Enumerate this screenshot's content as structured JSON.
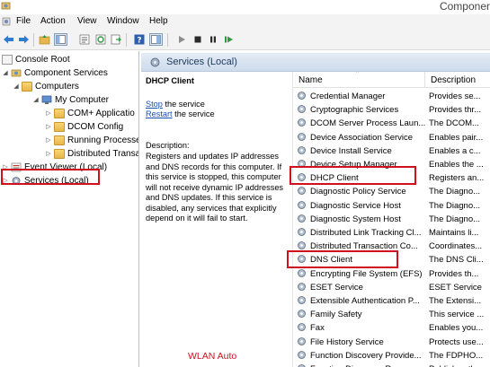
{
  "window": {
    "title": "Componer"
  },
  "menu": {
    "items": [
      "File",
      "Action",
      "View",
      "Window",
      "Help"
    ]
  },
  "toolbar": {
    "buttons": [
      "back-arrow-icon",
      "forward-arrow-icon",
      "up-folder-icon",
      "show-tree-icon",
      "properties-icon",
      "refresh-icon",
      "export-icon",
      "help-icon",
      "console-tree-icon",
      "play-icon",
      "stop-icon",
      "pause-icon",
      "restart-icon"
    ]
  },
  "tree": {
    "root": "Console Root",
    "component_services": "Component Services",
    "computers": "Computers",
    "my_computer": "My Computer",
    "com_apps": "COM+ Applicatio",
    "dcom_config": "DCOM Config",
    "running_processes": "Running Processe",
    "distributed_trans": "Distributed Transa",
    "event_viewer": "Event Viewer (Local)",
    "services_local": "Services (Local)"
  },
  "panel": {
    "header": "Services (Local)"
  },
  "description": {
    "service_name": "DHCP Client",
    "stop_link": "Stop",
    "stop_suffix": " the service",
    "restart_link": "Restart",
    "restart_suffix": " the service",
    "label": "Description:",
    "text": "Registers and updates IP addresses and DNS records for this computer. If this service is stopped, this computer will not receive dynamic IP addresses and DNS updates. If this service is disabled, any services that explicitly depend on it will fail to start."
  },
  "services_list": {
    "columns": {
      "name": "Name",
      "description": "Description"
    },
    "rows": [
      {
        "name": "Credential Manager",
        "description": "Provides se..."
      },
      {
        "name": "Cryptographic Services",
        "description": "Provides thr..."
      },
      {
        "name": "DCOM Server Process Laun...",
        "description": "The DCOM..."
      },
      {
        "name": "Device Association Service",
        "description": "Enables pair..."
      },
      {
        "name": "Device Install Service",
        "description": "Enables a c..."
      },
      {
        "name": "Device Setup Manager",
        "description": "Enables the ..."
      },
      {
        "name": "DHCP Client",
        "description": "Registers an..."
      },
      {
        "name": "Diagnostic Policy Service",
        "description": "The Diagno..."
      },
      {
        "name": "Diagnostic Service Host",
        "description": "The Diagno..."
      },
      {
        "name": "Diagnostic System Host",
        "description": "The Diagno..."
      },
      {
        "name": "Distributed Link Tracking Cl...",
        "description": "Maintains li..."
      },
      {
        "name": "Distributed Transaction Co...",
        "description": "Coordinates..."
      },
      {
        "name": "DNS Client",
        "description": "The DNS Cli..."
      },
      {
        "name": "Encrypting File System (EFS)",
        "description": "Provides th..."
      },
      {
        "name": "ESET Service",
        "description": "ESET Service"
      },
      {
        "name": "Extensible Authentication P...",
        "description": "The Extensi..."
      },
      {
        "name": "Family Safety",
        "description": "This service ..."
      },
      {
        "name": "Fax",
        "description": "Enables you..."
      },
      {
        "name": "File History Service",
        "description": "Protects use..."
      },
      {
        "name": "Function Discovery Provide...",
        "description": "The FDPHO..."
      },
      {
        "name": "Function Discovery Resour...",
        "description": "Publishes th..."
      }
    ]
  },
  "annotation": {
    "text": "WLAN Auto"
  },
  "colors": {
    "highlight": "#d0101e",
    "link": "#1a4fb3",
    "header_text": "#1e395b"
  }
}
